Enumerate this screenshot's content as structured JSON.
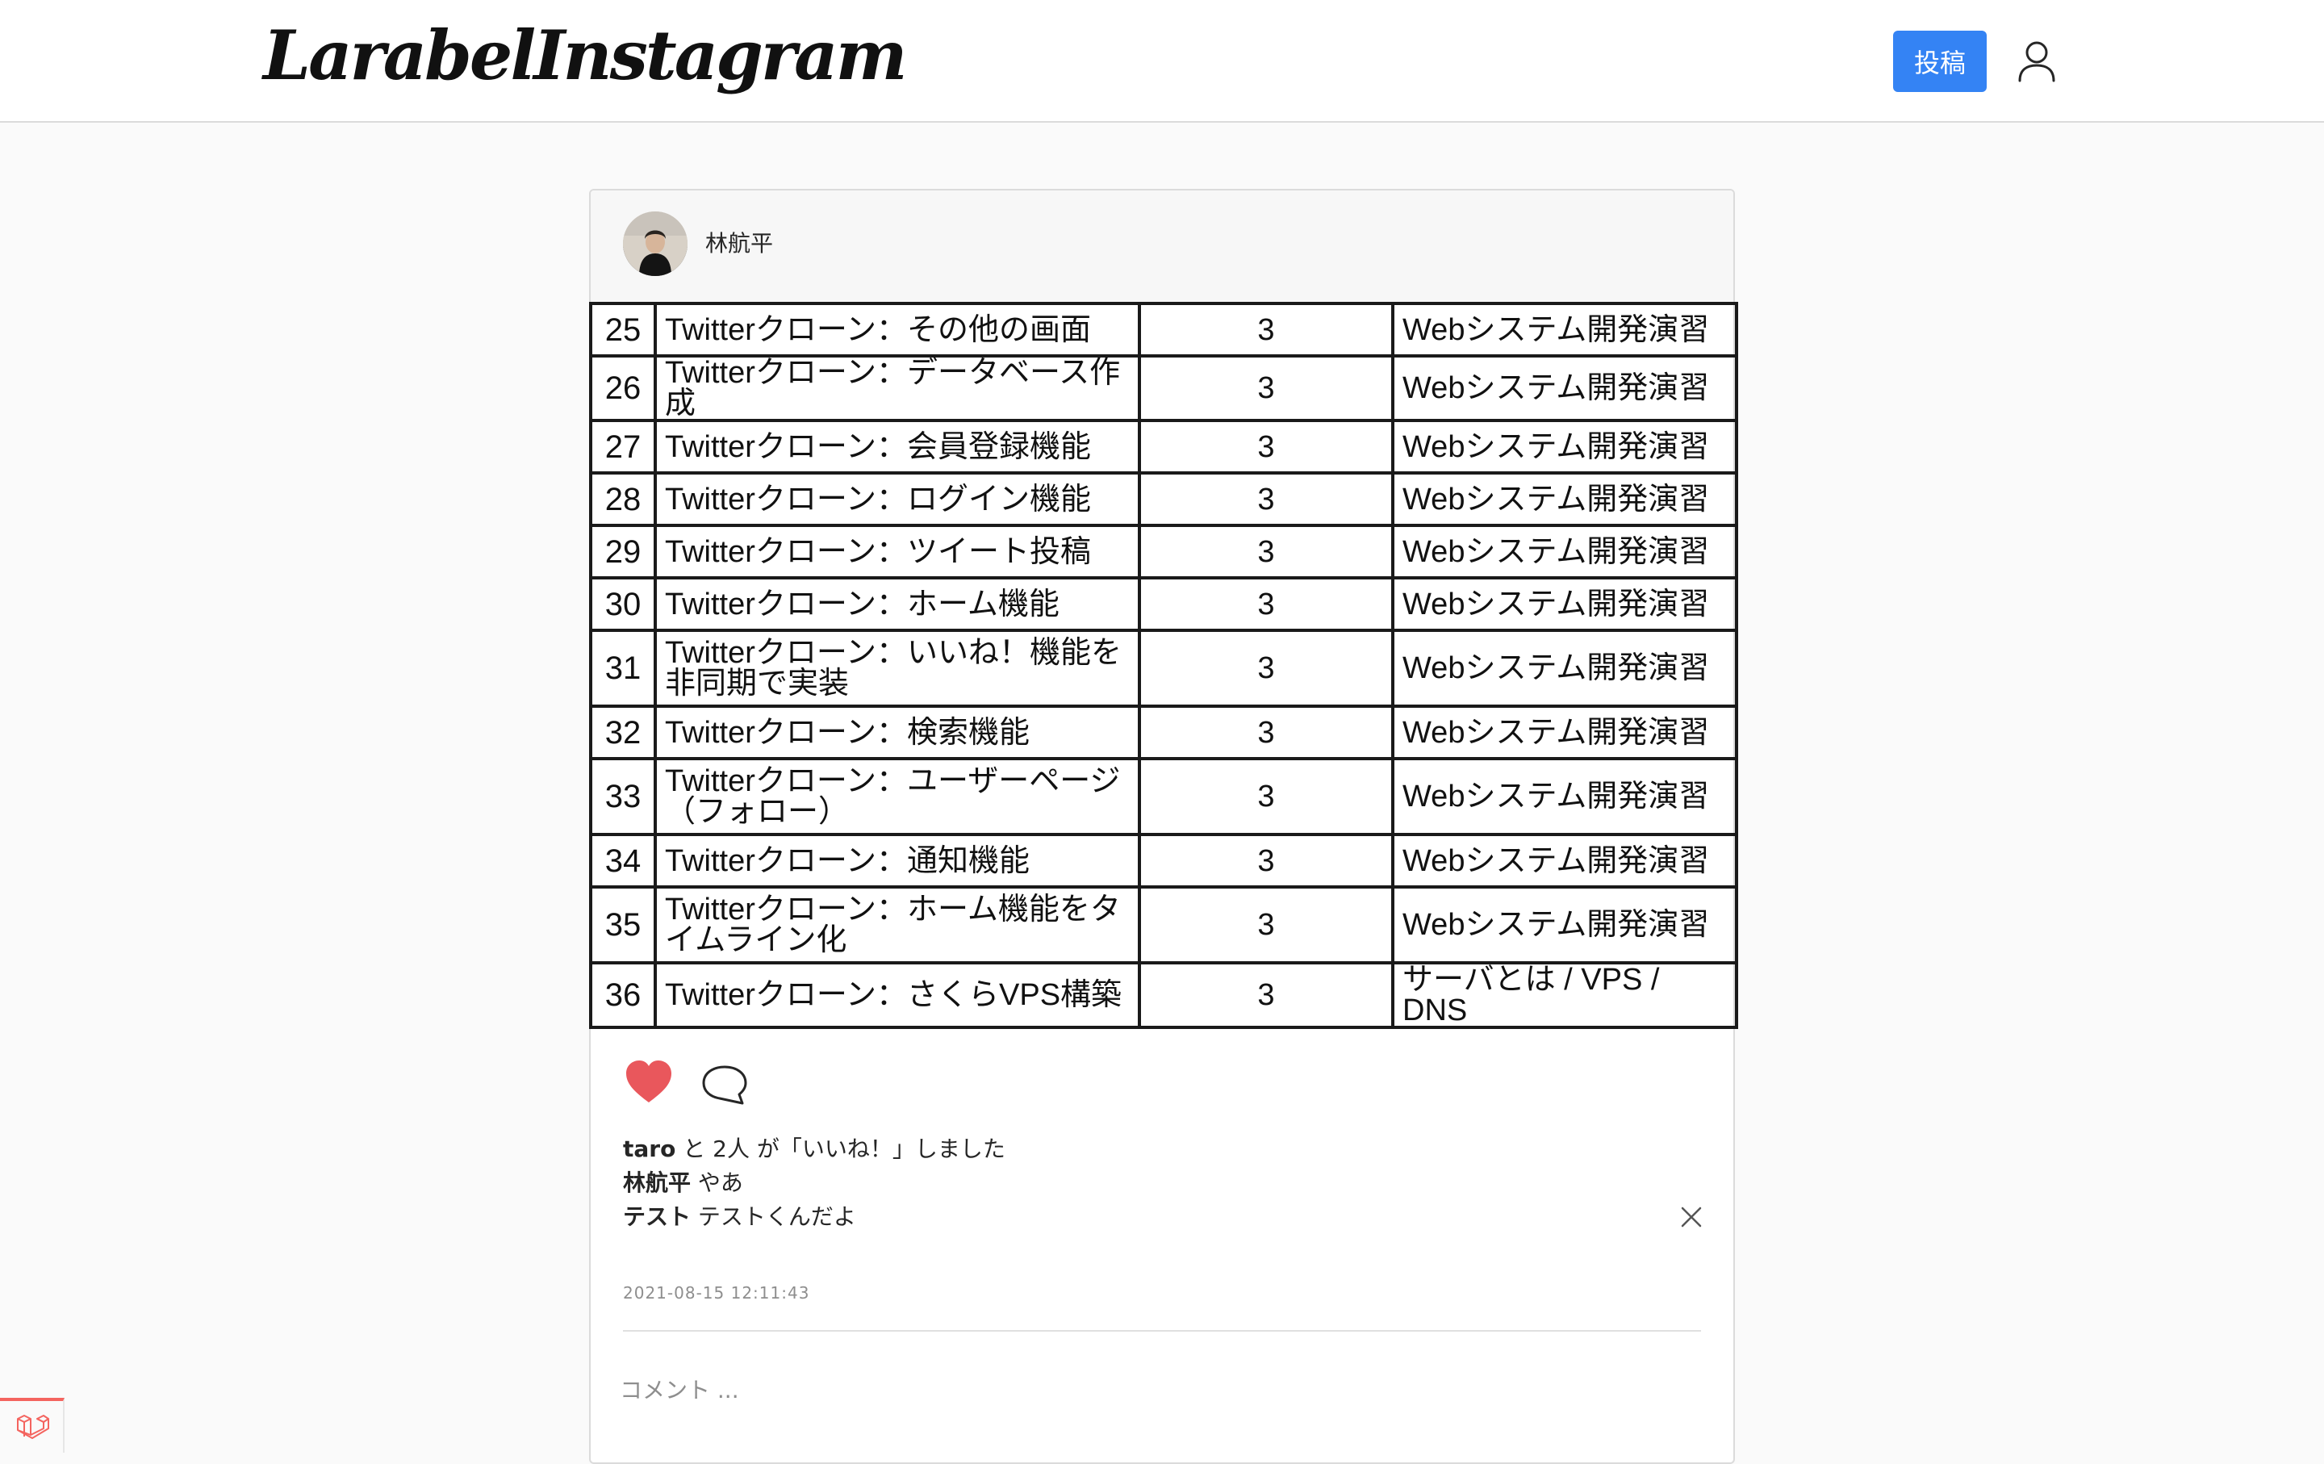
{
  "header": {
    "logo_text": "LarabelInstagram",
    "post_button_label": "投稿",
    "accent_color": "#3483f4"
  },
  "post": {
    "author": "林航平",
    "image_table": {
      "rows": [
        {
          "no": "25",
          "title": "Twitterクローン：その他の画面",
          "credits": "3",
          "course": "Webシステム開発演習"
        },
        {
          "no": "26",
          "title": "Twitterクローン：データベース作成",
          "credits": "3",
          "course": "Webシステム開発演習"
        },
        {
          "no": "27",
          "title": "Twitterクローン：会員登録機能",
          "credits": "3",
          "course": "Webシステム開発演習"
        },
        {
          "no": "28",
          "title": "Twitterクローン：ログイン機能",
          "credits": "3",
          "course": "Webシステム開発演習"
        },
        {
          "no": "29",
          "title": "Twitterクローン：ツイート投稿",
          "credits": "3",
          "course": "Webシステム開発演習"
        },
        {
          "no": "30",
          "title": "Twitterクローン：ホーム機能",
          "credits": "3",
          "course": "Webシステム開発演習"
        },
        {
          "no": "31",
          "title": "Twitterクローン：いいね！機能を非同期で実装",
          "credits": "3",
          "course": "Webシステム開発演習"
        },
        {
          "no": "32",
          "title": "Twitterクローン：検索機能",
          "credits": "3",
          "course": "Webシステム開発演習"
        },
        {
          "no": "33",
          "title": "Twitterクローン：ユーザーページ（フォロー）",
          "credits": "3",
          "course": "Webシステム開発演習"
        },
        {
          "no": "34",
          "title": "Twitterクローン：通知機能",
          "credits": "3",
          "course": "Webシステム開発演習"
        },
        {
          "no": "35",
          "title": "Twitterクローン：ホーム機能をタイムライン化",
          "credits": "3",
          "course": "Webシステム開発演習"
        },
        {
          "no": "36",
          "title": "Twitterクローン：さくらVPS構築",
          "credits": "3",
          "course": "サーバとは / VPS / DNS"
        }
      ]
    },
    "liked": true,
    "like_color": "#ed4956",
    "likes": {
      "user": "taro",
      "text": " と 2人 が「いいね！」しました"
    },
    "comments": [
      {
        "user": "林航平",
        "text": " やあ"
      },
      {
        "user": "テスト",
        "text": " テストくんだよ"
      }
    ],
    "timestamp": "2021-08-15 12:11:43",
    "comment_placeholder": "コメント ..."
  },
  "icons": {
    "user": "user-icon",
    "like": "heart-icon",
    "comment": "comment-icon",
    "delete": "close-icon",
    "debug": "laravel-icon"
  }
}
